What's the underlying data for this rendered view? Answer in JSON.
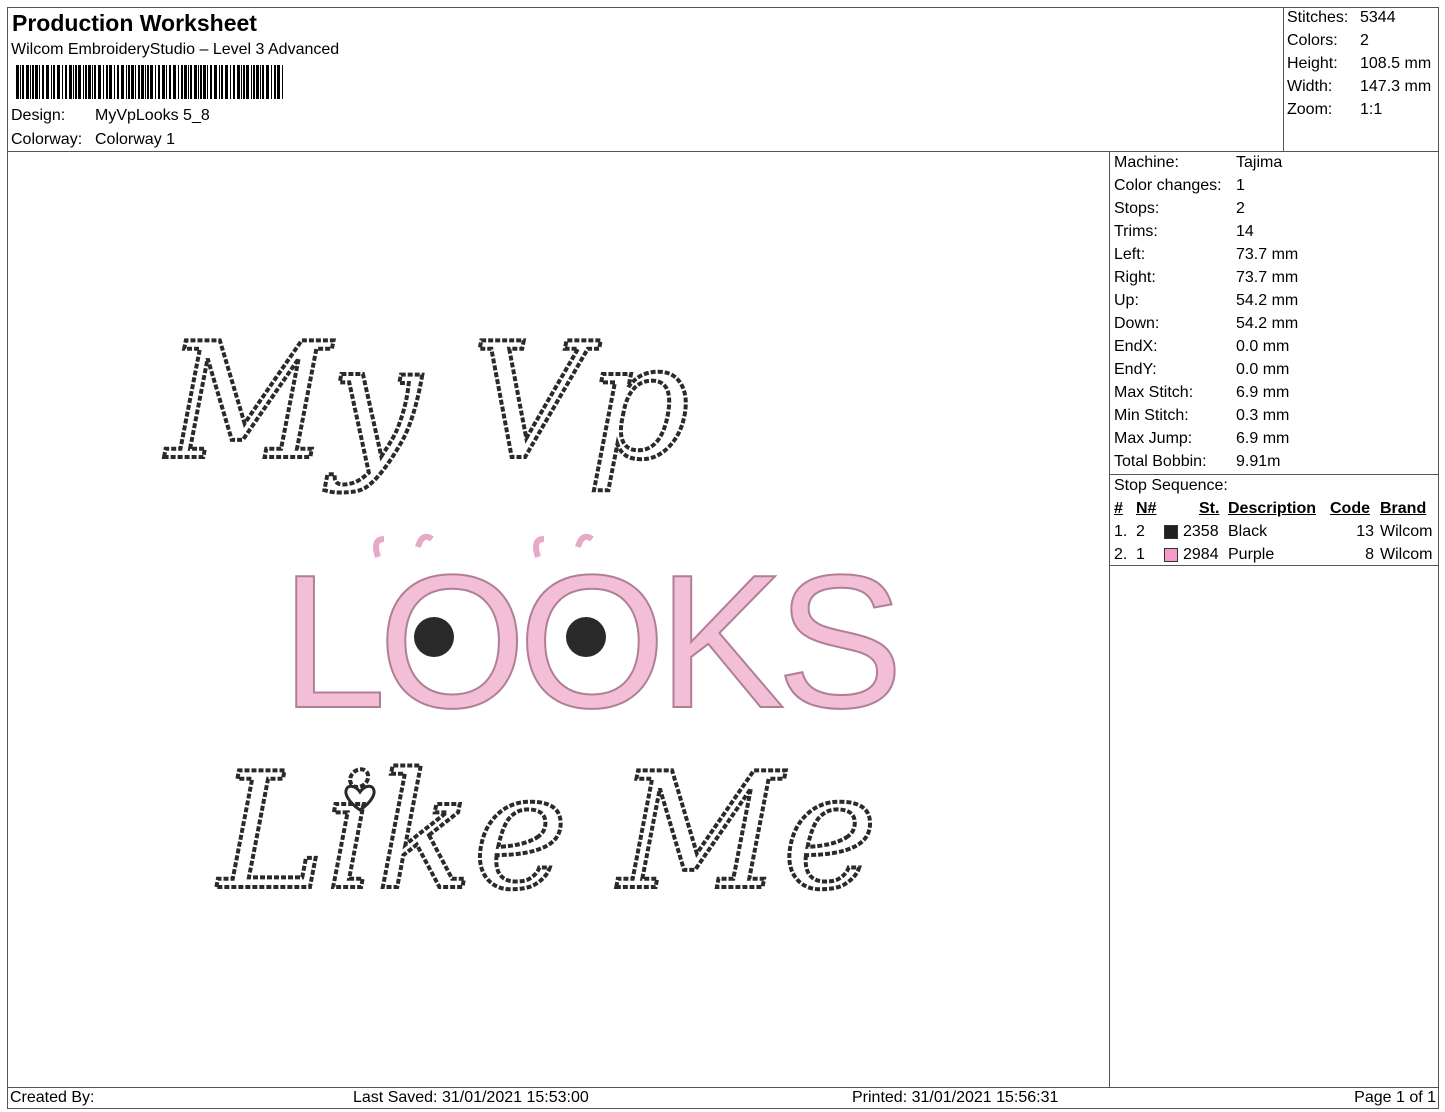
{
  "header": {
    "title": "Production Worksheet",
    "software": "Wilcom EmbroideryStudio – Level 3 Advanced",
    "design_label": "Design:",
    "design_value": "MyVpLooks 5_8",
    "colorway_label": "Colorway:",
    "colorway_value": "Colorway 1"
  },
  "stats": [
    {
      "label": "Stitches:",
      "value": "5344"
    },
    {
      "label": "Colors:",
      "value": "2"
    },
    {
      "label": "Height:",
      "value": "108.5 mm"
    },
    {
      "label": "Width:",
      "value": "147.3 mm"
    },
    {
      "label": "Zoom:",
      "value": "1:1"
    }
  ],
  "info": [
    {
      "label": "Machine:",
      "value": "Tajima"
    },
    {
      "label": "Color changes:",
      "value": "1"
    },
    {
      "label": "Stops:",
      "value": "2"
    },
    {
      "label": "Trims:",
      "value": "14"
    },
    {
      "label": "Left:",
      "value": "73.7 mm"
    },
    {
      "label": "Right:",
      "value": "73.7 mm"
    },
    {
      "label": "Up:",
      "value": "54.2 mm"
    },
    {
      "label": "Down:",
      "value": "54.2 mm"
    },
    {
      "label": "EndX:",
      "value": "0.0 mm"
    },
    {
      "label": "EndY:",
      "value": "0.0 mm"
    },
    {
      "label": "Max Stitch:",
      "value": "6.9 mm"
    },
    {
      "label": "Min Stitch:",
      "value": "0.3 mm"
    },
    {
      "label": "Max Jump:",
      "value": "6.9 mm"
    },
    {
      "label": "Total Bobbin:",
      "value": "9.91m"
    }
  ],
  "stop_sequence": {
    "title": "Stop Sequence:",
    "headers": [
      "#",
      "N#",
      "St.",
      "Description",
      "Code",
      "Brand"
    ],
    "rows": [
      {
        "num": "1.",
        "n": "2",
        "color": "#231f20",
        "st": "2358",
        "desc": "Black",
        "code": "13",
        "brand": "Wilcom"
      },
      {
        "num": "2.",
        "n": "1",
        "color": "#f49ac8",
        "st": "2984",
        "desc": "Purple",
        "code": "8",
        "brand": "Wilcom"
      }
    ]
  },
  "design_text": {
    "line1": "My Vp",
    "line2": "LOOKS",
    "line3": "Like Me"
  },
  "colors": {
    "black_thread": "#2a2a2a",
    "pink_thread": "#f2bfd6"
  },
  "footer": {
    "created": "Created By:",
    "saved": "Last Saved: 31/01/2021 15:53:00",
    "printed": "Printed: 31/01/2021 15:56:31",
    "page": "Page 1 of 1"
  }
}
